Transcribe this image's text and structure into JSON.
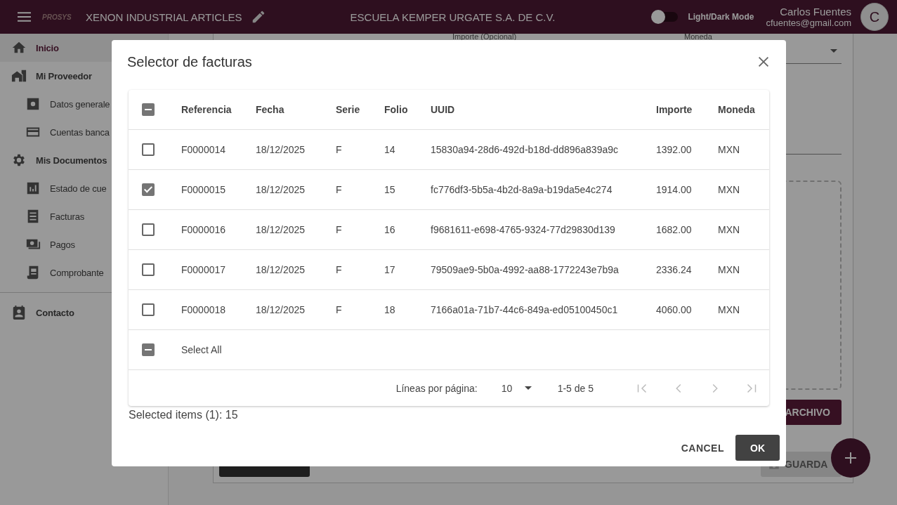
{
  "header": {
    "logo": "PROSYS",
    "app_title": "XENON INDUSTRIAL ARTICLES",
    "company": "ESCUELA KEMPER URGATE S.A. DE C.V.",
    "theme_toggle": {
      "label": "Light/Dark Mode",
      "on": false
    },
    "user": {
      "name": "Carlos Fuentes",
      "email": "cfuentes@gmail.com",
      "initial": "C"
    }
  },
  "sidebar": {
    "items": [
      {
        "label": "Inicio",
        "active": true
      },
      {
        "label": "Mi Proveedor",
        "active": false,
        "children": [
          {
            "label": "Datos generale",
            "active": false
          },
          {
            "label": "Cuentas banca",
            "active": false
          }
        ]
      },
      {
        "label": "Mis Documentos",
        "active": false,
        "children": [
          {
            "label": "Estado de cue",
            "active": false
          },
          {
            "label": "Facturas",
            "active": false
          },
          {
            "label": "Pagos",
            "active": false
          },
          {
            "label": "Comprobante",
            "active": false
          }
        ]
      },
      {
        "label": "Contacto",
        "active": false
      }
    ]
  },
  "form": {
    "amount_label": "Importe (Opcional)",
    "currency_label": "Moneda",
    "upload_button": "ARCHIVO",
    "save_button": "GUARDA"
  },
  "dialog": {
    "title": "Selector de facturas",
    "table": {
      "columns": [
        "Referencia",
        "Fecha",
        "Serie",
        "Folio",
        "UUID",
        "Importe",
        "Moneda"
      ],
      "header_indeterminate": true,
      "rows": [
        {
          "selected": false,
          "cells": [
            "F0000014",
            "18/12/2025",
            "F",
            "14",
            "15830a94-28d6-492d-b18d-dd896a839a9c",
            "1392.00",
            "MXN"
          ]
        },
        {
          "selected": true,
          "cells": [
            "F0000015",
            "18/12/2025",
            "F",
            "15",
            "fc776df3-5b5a-4b2d-8a9a-b19da5e4c274",
            "1914.00",
            "MXN"
          ]
        },
        {
          "selected": false,
          "cells": [
            "F0000016",
            "18/12/2025",
            "F",
            "16",
            "f9681611-e698-4765-9324-77d29830d139",
            "1682.00",
            "MXN"
          ]
        },
        {
          "selected": false,
          "cells": [
            "F0000017",
            "18/12/2025",
            "F",
            "17",
            "79509ae9-5b0a-4992-aa88-1772243e7b9a",
            "2336.24",
            "MXN"
          ]
        },
        {
          "selected": false,
          "cells": [
            "F0000018",
            "18/12/2025",
            "F",
            "18",
            "7166a01a-71b7-44c6-849a-ed05100450c1",
            "4060.00",
            "MXN"
          ]
        }
      ],
      "select_all": {
        "label": "Select All",
        "indeterminate": true
      }
    },
    "pagination": {
      "rows_label": "Líneas por página:",
      "rows_value": "10",
      "range": "1-5 de 5",
      "first_disabled": true,
      "prev_disabled": true,
      "next_disabled": true,
      "last_disabled": true
    },
    "selected_summary": "Selected items (1): 15",
    "buttons": [
      "CANCEL",
      "OK"
    ]
  }
}
